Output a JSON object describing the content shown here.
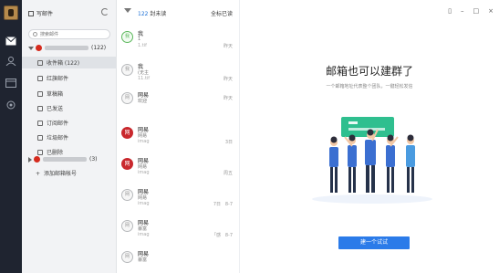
{
  "sidebar": {
    "compose_label": "写邮件",
    "search_placeholder": "搜索邮件",
    "account1_count": "(122)",
    "account2_count": "(3)",
    "folders": [
      {
        "label": "收件箱 (122)",
        "icon": "inbox-icon"
      },
      {
        "label": "红旗邮件",
        "icon": "flag-icon"
      },
      {
        "label": "草稿箱",
        "icon": "draft-icon"
      },
      {
        "label": "已发送",
        "icon": "sent-icon"
      },
      {
        "label": "订阅邮件",
        "icon": "subscribe-icon"
      },
      {
        "label": "垃圾邮件",
        "icon": "spam-icon"
      },
      {
        "label": "已删除",
        "icon": "trash-icon"
      }
    ],
    "add_mailbox_label": "添加邮箱帐号"
  },
  "list": {
    "unread_count": "122",
    "unread_label": "封未读",
    "read_all_label": "全标已读",
    "messages": [
      {
        "avatar": "我",
        "sender": "我",
        "subject": "1",
        "preview": "1.tif",
        "date": "昨天"
      },
      {
        "avatar": "我",
        "sender": "我",
        "subject": "(无主",
        "preview": "11.tif",
        "date": "昨天"
      },
      {
        "avatar": "网",
        "sender": "网易",
        "subject": "欢迎",
        "preview": "",
        "date": "昨天"
      },
      {
        "avatar": "网",
        "sender": "网易",
        "subject": "网易",
        "preview": "imag",
        "date": "3日"
      },
      {
        "avatar": "网",
        "sender": "网易",
        "subject": "网易",
        "preview": "imag",
        "date": "周五"
      },
      {
        "avatar": "网",
        "sender": "网易",
        "subject": "网易",
        "preview": "imag",
        "date": "7日"
      },
      {
        "avatar": "网",
        "sender": "网易",
        "subject": "暴富",
        "preview": "imag",
        "date": "「感"
      },
      {
        "avatar": "网",
        "sender": "网易",
        "subject": "暴富",
        "preview": "",
        "date": ""
      }
    ],
    "date_suffixes": [
      "",
      "",
      "",
      "",
      "",
      "8-7",
      "8-7",
      ""
    ]
  },
  "main": {
    "headline": "邮箱也可以建群了",
    "subline": "一个邮箱地址代表整个团队，一键轻松发信",
    "cta_label": "建一个试试",
    "accent": "#2b7be9"
  }
}
